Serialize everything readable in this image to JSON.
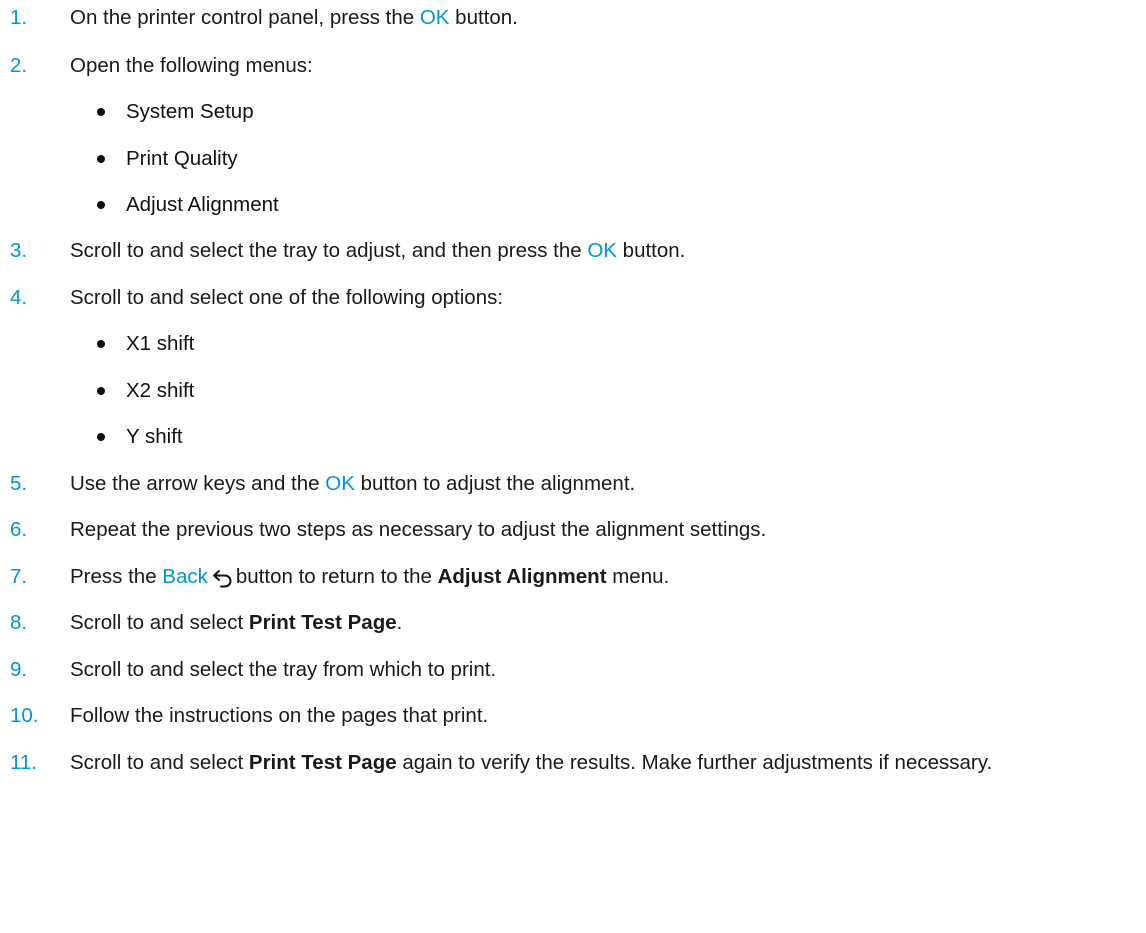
{
  "steps": [
    {
      "num": "1.",
      "a": "On the printer control panel, press the ",
      "ok": "OK",
      "b": " button."
    },
    {
      "num": "2.",
      "text": "Open the following menus:"
    },
    {
      "num": "3.",
      "a": "Scroll to and select the tray to adjust, and then press the ",
      "ok": "OK",
      "b": " button."
    },
    {
      "num": "4.",
      "text": "Scroll to and select one of the following options:"
    },
    {
      "num": "5.",
      "a": "Use the arrow keys and the ",
      "ok": "OK",
      "b": " button to adjust the alignment."
    },
    {
      "num": "6.",
      "text": "Repeat the previous two steps as necessary to adjust the alignment settings."
    },
    {
      "num": "7.",
      "a": "Press the ",
      "back": "Back",
      "b": "button to return to the ",
      "menu": "Adjust Alignment",
      "c": " menu."
    },
    {
      "num": "8.",
      "a": "Scroll to and select ",
      "item": "Print Test Page",
      "b": "."
    },
    {
      "num": "9.",
      "text": "Scroll to and select the tray from which to print."
    },
    {
      "num": "10.",
      "text": "Follow the instructions on the pages that print."
    },
    {
      "num": "11.",
      "a": "Scroll to and select ",
      "item": "Print Test Page",
      "b": " again to verify the results. Make further adjustments if necessary."
    }
  ],
  "menus": [
    "System Setup",
    "Print Quality",
    "Adjust Alignment"
  ],
  "options": [
    "X1 shift",
    "X2 shift",
    "Y shift"
  ],
  "colors": {
    "accent": "#0096d6",
    "text": "#1a1a1a"
  },
  "icons": {
    "back": "back-arrow-icon"
  }
}
